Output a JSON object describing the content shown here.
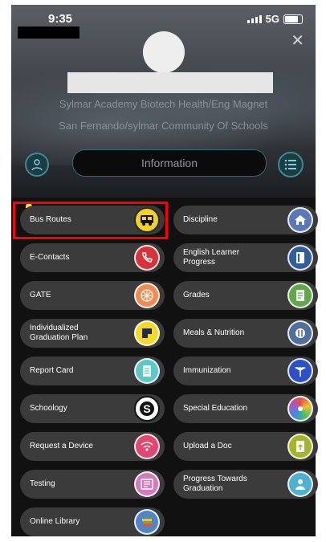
{
  "status": {
    "time": "9:35",
    "network": "5G"
  },
  "school": {
    "line1": "Sylmar Academy Biotech Health/Eng Magnet",
    "line2": "San Fernando/sylmar Community Of Schools"
  },
  "info_label": "Information",
  "items": [
    {
      "label": "Bus Routes",
      "icon": "bus-icon",
      "color": "#f2d222"
    },
    {
      "label": "Discipline",
      "icon": "home-icon",
      "color": "#5a78b4"
    },
    {
      "label": "E-Contacts",
      "icon": "phone-icon",
      "color": "#d8323b"
    },
    {
      "label": "English Learner\nProgress",
      "icon": "book-icon",
      "color": "#2f5e9d"
    },
    {
      "label": "GATE",
      "icon": "gate-icon",
      "color": "#f08c52"
    },
    {
      "label": "Grades",
      "icon": "document-icon",
      "color": "#61a84a"
    },
    {
      "label": "Individualized\nGraduation Plan",
      "icon": "plan-icon",
      "color": "#f2da2a"
    },
    {
      "label": "Meals & Nutrition",
      "icon": "utensils-icon",
      "color": "#516f9c"
    },
    {
      "label": "Report Card",
      "icon": "report-card-icon",
      "color": "#5cc9c9"
    },
    {
      "label": "Immunization",
      "icon": "caduceus-icon",
      "color": "#2c50c8"
    },
    {
      "label": "Schoology",
      "icon": "schoology-icon",
      "color": "#111111"
    },
    {
      "label": "Special Education",
      "icon": "puzzle-icon",
      "color": "#9c5bd1"
    },
    {
      "label": "Request a Device",
      "icon": "wifi-icon",
      "color": "#e2476f"
    },
    {
      "label": "Upload a Doc",
      "icon": "upload-doc-icon",
      "color": "#a6b42a"
    },
    {
      "label": "Testing",
      "icon": "testing-icon",
      "color": "#d37bb9"
    },
    {
      "label": "Progress Towards\nGraduation",
      "icon": "graduation-icon",
      "color": "#4fb0cf"
    },
    {
      "label": "Online Library",
      "icon": "library-icon",
      "color": "#4e86c8"
    }
  ]
}
